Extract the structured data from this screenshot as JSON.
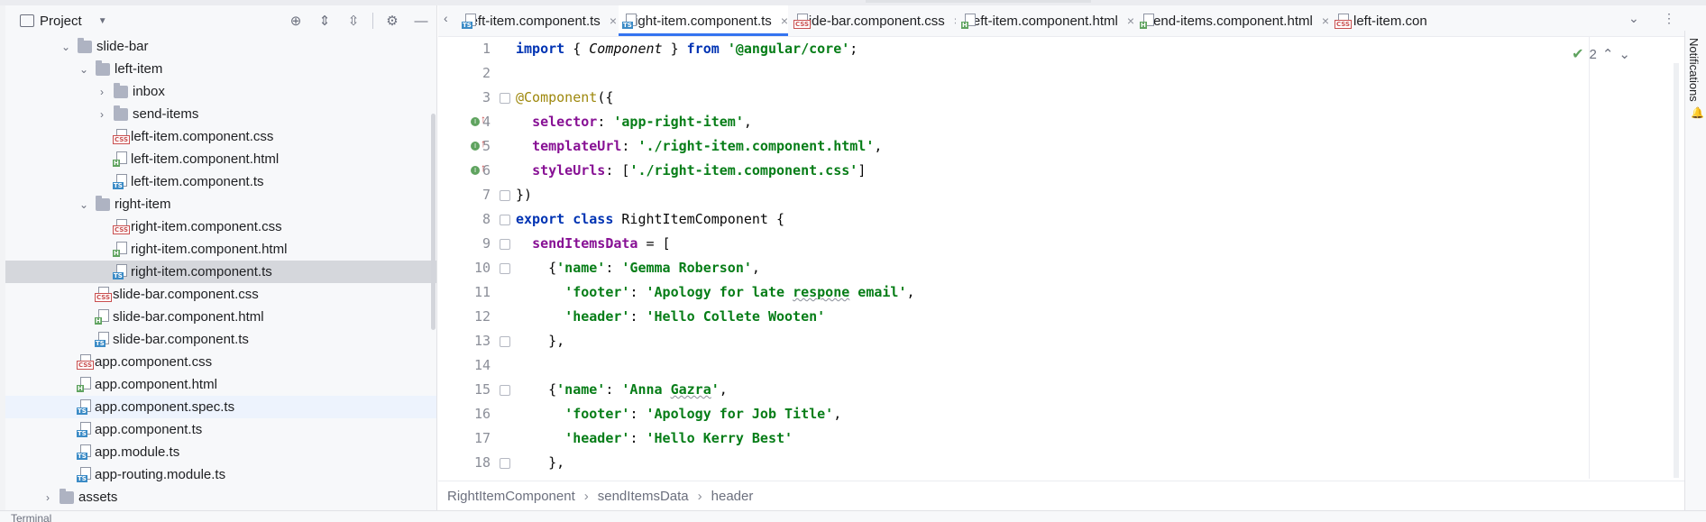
{
  "project_panel": {
    "title": "Project",
    "toolbar_icons": [
      "locate-icon",
      "expand-all-icon",
      "collapse-all-icon",
      "gear-icon",
      "minimize-icon"
    ],
    "tree": [
      {
        "label": "slide-bar",
        "kind": "folder",
        "depth": 1,
        "expanded": true
      },
      {
        "label": "left-item",
        "kind": "folder",
        "depth": 2,
        "expanded": true
      },
      {
        "label": "inbox",
        "kind": "folder",
        "depth": 3,
        "expanded": false
      },
      {
        "label": "send-items",
        "kind": "folder",
        "depth": 3,
        "expanded": false
      },
      {
        "label": "left-item.component.css",
        "kind": "css",
        "depth": 3
      },
      {
        "label": "left-item.component.html",
        "kind": "html",
        "depth": 3
      },
      {
        "label": "left-item.component.ts",
        "kind": "ts",
        "depth": 3
      },
      {
        "label": "right-item",
        "kind": "folder",
        "depth": 2,
        "expanded": true
      },
      {
        "label": "right-item.component.css",
        "kind": "css",
        "depth": 3
      },
      {
        "label": "right-item.component.html",
        "kind": "html",
        "depth": 3
      },
      {
        "label": "right-item.component.ts",
        "kind": "ts",
        "depth": 3,
        "selected": true
      },
      {
        "label": "slide-bar.component.css",
        "kind": "css",
        "depth": 2
      },
      {
        "label": "slide-bar.component.html",
        "kind": "html",
        "depth": 2
      },
      {
        "label": "slide-bar.component.ts",
        "kind": "ts",
        "depth": 2
      },
      {
        "label": "app.component.css",
        "kind": "css",
        "depth": 1
      },
      {
        "label": "app.component.html",
        "kind": "html",
        "depth": 1
      },
      {
        "label": "app.component.spec.ts",
        "kind": "spec",
        "depth": 1,
        "highlighted": true
      },
      {
        "label": "app.component.ts",
        "kind": "ts",
        "depth": 1
      },
      {
        "label": "app.module.ts",
        "kind": "ts",
        "depth": 1
      },
      {
        "label": "app-routing.module.ts",
        "kind": "ts",
        "depth": 1
      },
      {
        "label": "assets",
        "kind": "folder",
        "depth": 0,
        "expanded": false
      }
    ]
  },
  "tabs": [
    {
      "label": "left-item.component.ts",
      "kind": "ts"
    },
    {
      "label": "right-item.component.ts",
      "kind": "ts",
      "active": true
    },
    {
      "label": "slide-bar.component.css",
      "kind": "css"
    },
    {
      "label": "left-item.component.html",
      "kind": "html"
    },
    {
      "label": "send-items.component.html",
      "kind": "html"
    },
    {
      "label": "left-item.con",
      "kind": "css"
    }
  ],
  "editor": {
    "line_numbers": [
      "1",
      "2",
      "3",
      "4",
      "5",
      "6",
      "7",
      "8",
      "9",
      "10",
      "11",
      "12",
      "13",
      "14",
      "15",
      "16",
      "17",
      "18"
    ],
    "inspections_count": "2",
    "lines": {
      "l1": {
        "kw": "import",
        "p1": " { ",
        "id": "Component",
        "p2": " } ",
        "kw2": "from",
        "str": "'@angular/core'",
        "end": ";"
      },
      "l3": {
        "ann": "@Component",
        "p": "({"
      },
      "l4": {
        "prop": "selector",
        "p": ": ",
        "str": "'app-right-item'",
        "end": ","
      },
      "l5": {
        "prop": "templateUrl",
        "p": ": ",
        "str": "'./right-item.component.html'",
        "end": ","
      },
      "l6": {
        "prop": "styleUrls",
        "p": ": [",
        "str": "'./right-item.component.css'",
        "end": "]"
      },
      "l7": {
        "p": "})"
      },
      "l8": {
        "kw": "export",
        "kw2": "class",
        "name": "RightItemComponent",
        "end": " {"
      },
      "l9": {
        "prop": "sendItemsData",
        "end": " = ["
      },
      "l10": {
        "p": "{",
        "key": "'name'",
        "sep": ": ",
        "str": "'Gemma Roberson'",
        "end": ","
      },
      "l11": {
        "key": "'footer'",
        "sep": ": ",
        "str1": "'Apology for late ",
        "wavy": "respone",
        "str2": " email'",
        "end": ","
      },
      "l12": {
        "key": "'header'",
        "sep": ": ",
        "str": "'Hello Collete Wooten'"
      },
      "l13": {
        "p": "},"
      },
      "l15": {
        "p": "{",
        "key": "'name'",
        "sep": ": ",
        "str1": "'Anna ",
        "wavy": "Gazra",
        "str2": "'",
        "end": ","
      },
      "l16": {
        "key": "'footer'",
        "sep": ": ",
        "str": "'Apology for Job Title'",
        "end": ","
      },
      "l17": {
        "key": "'header'",
        "sep": ": ",
        "str": "'Hello Kerry Best'"
      },
      "l18": {
        "p": "},"
      }
    }
  },
  "breadcrumbs": [
    "RightItemComponent",
    "sendItemsData",
    "header"
  ],
  "right_strip": {
    "label": "Notifications"
  },
  "bottom": {
    "text": "Terminal"
  }
}
